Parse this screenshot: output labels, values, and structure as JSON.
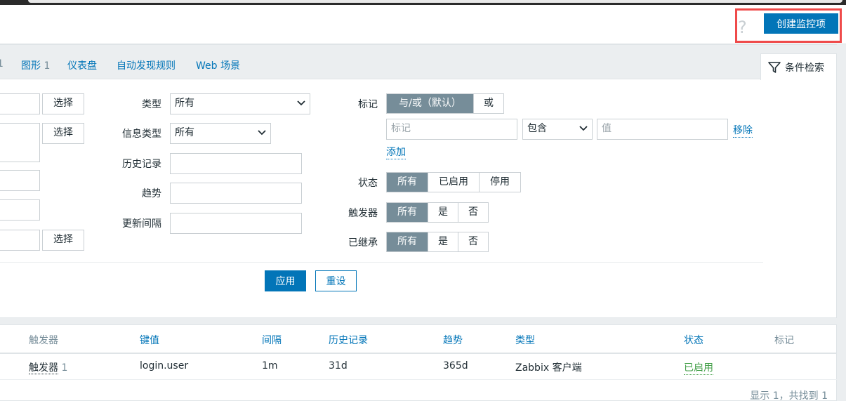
{
  "header": {
    "help_icon": "?",
    "create_button": "创建监控项"
  },
  "tabs": {
    "first_count": "1",
    "graphs_label": "图形",
    "graphs_count": "1",
    "dashboards": "仪表盘",
    "discovery": "自动发现规则",
    "web": "Web 场景",
    "filter": "条件检索"
  },
  "filter": {
    "select_label": "选择",
    "type_label": "类型",
    "type_value": "所有",
    "info_type_label": "信息类型",
    "info_type_value": "所有",
    "history_label": "历史记录",
    "history_value": "",
    "trends_label": "趋势",
    "trends_value": "",
    "interval_label": "更新间隔",
    "interval_value": "",
    "tags_label": "标记",
    "tag_andor": "与/或（默认）",
    "tag_or": "或",
    "tag_name_placeholder": "标记",
    "tag_operator": "包含",
    "tag_value_placeholder": "值",
    "remove": "移除",
    "add": "添加",
    "state_label": "状态",
    "state_options": [
      "所有",
      "已启用",
      "停用"
    ],
    "trigger_label": "触发器",
    "trigger_options": [
      "所有",
      "是",
      "否"
    ],
    "inherited_label": "已继承",
    "inherited_options": [
      "所有",
      "是",
      "否"
    ],
    "apply": "应用",
    "reset": "重设"
  },
  "table": {
    "headers": {
      "triggers": "触发器",
      "key": "键值",
      "interval": "间隔",
      "history": "历史记录",
      "trends": "趋势",
      "type": "类型",
      "status": "状态",
      "tags": "标记"
    },
    "rows": [
      {
        "triggers": "触发器",
        "triggers_count": "1",
        "key": "login.user",
        "interval": "1m",
        "history": "31d",
        "trends": "365d",
        "type": "Zabbix 客户端",
        "status": "已启用"
      }
    ],
    "summary": "显示 1，共找到 1"
  },
  "colors": {
    "accent": "#0275b8",
    "highlight": "#ef4a4a",
    "status_enabled": "#429e47",
    "segment_active": "#768d99"
  }
}
